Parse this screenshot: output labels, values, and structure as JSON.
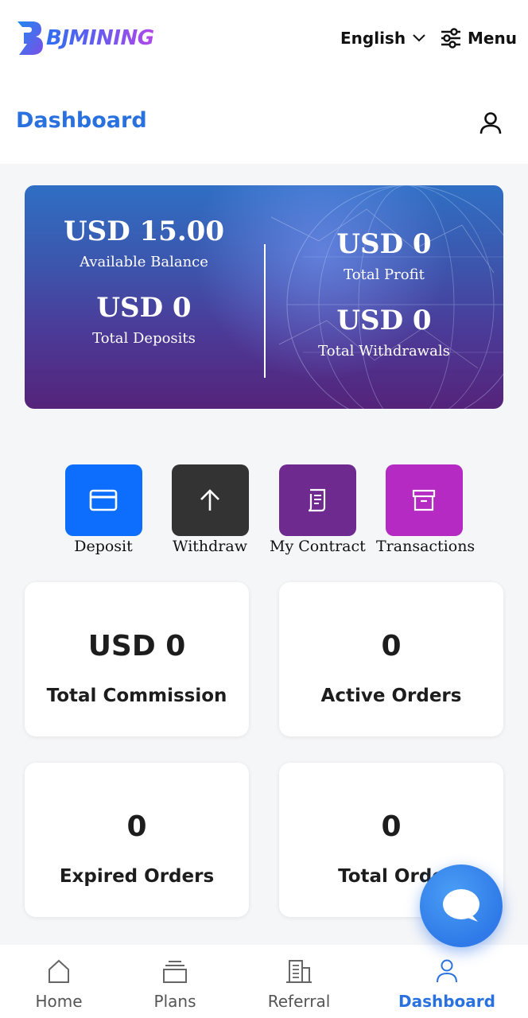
{
  "header": {
    "brand": "BJMINING",
    "language": "English",
    "menu_label": "Menu"
  },
  "dashboard": {
    "title": "Dashboard"
  },
  "balance": {
    "available_amount": "USD 15.00",
    "available_label": "Available Balance",
    "deposits_amount": "USD 0",
    "deposits_label": "Total Deposits",
    "profit_amount": "USD 0",
    "profit_label": "Total Profit",
    "withdrawals_amount": "USD 0",
    "withdrawals_label": "Total Withdrawals"
  },
  "quick_actions": [
    {
      "label": "Deposit",
      "icon": "credit-card-icon",
      "color": "#0d6efd"
    },
    {
      "label": "Withdraw",
      "icon": "arrow-up-icon",
      "color": "#333333"
    },
    {
      "label": "My Contract",
      "icon": "document-icon",
      "color": "#6f2a8f"
    },
    {
      "label": "Transactions",
      "icon": "archive-box-icon",
      "color": "#b42ac2"
    }
  ],
  "stats": [
    {
      "value": "USD 0",
      "label": "Total Commission"
    },
    {
      "value": "0",
      "label": "Active Orders"
    },
    {
      "value": "0",
      "label": "Expired Orders"
    },
    {
      "value": "0",
      "label": "Total Orde"
    }
  ],
  "nav": [
    {
      "label": "Home",
      "icon": "home-icon",
      "active": false
    },
    {
      "label": "Plans",
      "icon": "layers-icon",
      "active": false
    },
    {
      "label": "Referral",
      "icon": "building-icon",
      "active": false
    },
    {
      "label": "Dashboard",
      "icon": "user-icon",
      "active": true
    }
  ],
  "colors": {
    "accent": "#2a71e0",
    "page_bg": "#f5f6f8"
  }
}
